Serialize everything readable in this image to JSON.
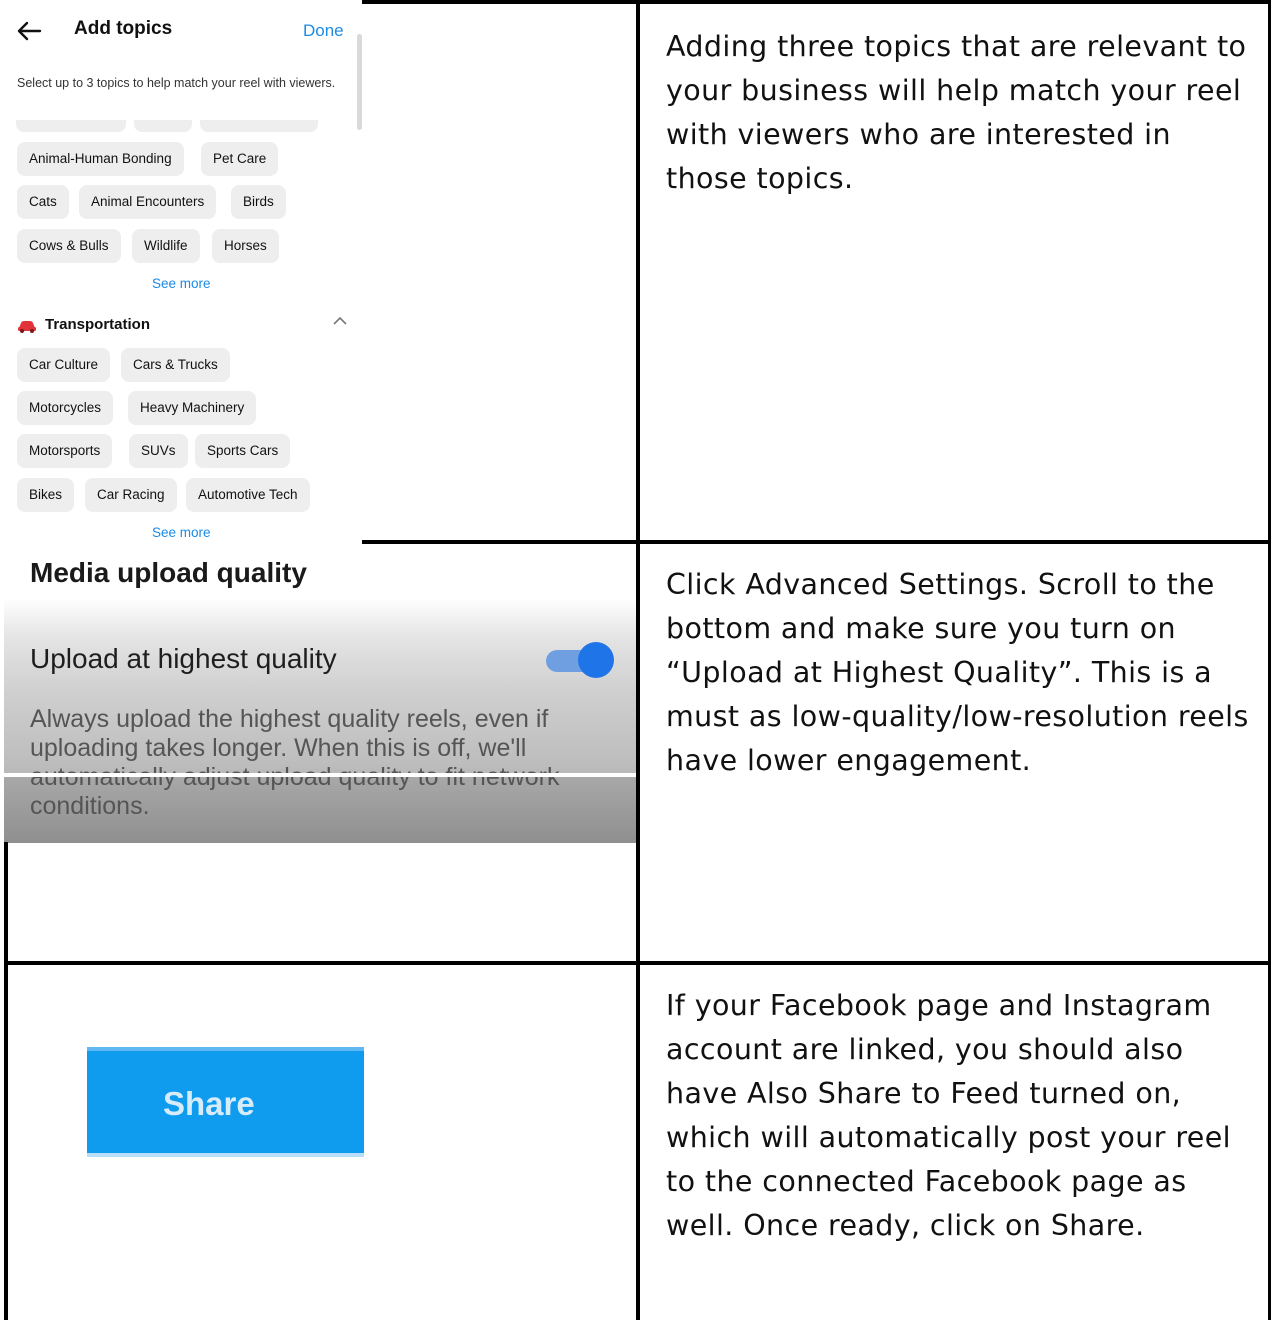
{
  "topics_screen": {
    "title": "Add topics",
    "done_label": "Done",
    "help_text": "Select up to 3 topics to help match your reel with viewers.",
    "animals_chips": [
      "Animal-Human Bonding",
      "Pet Care",
      "Cats",
      "Animal Encounters",
      "Birds",
      "Cows & Bulls",
      "Wildlife",
      "Horses"
    ],
    "see_more_label": "See more",
    "category": {
      "title": "Transportation",
      "chips": [
        "Car Culture",
        "Cars & Trucks",
        "Motorcycles",
        "Heavy Machinery",
        "Motorsports",
        "SUVs",
        "Sports Cars",
        "Bikes",
        "Car Racing",
        "Automotive Tech"
      ]
    },
    "accent_color": "#1c8be6"
  },
  "quality_screen": {
    "heading": "Media upload quality",
    "setting_label": "Upload at highest quality",
    "toggle_on": true,
    "description": "Always upload the highest quality reels, even if uploading takes longer. When this is off, we'll automatically adjust upload quality to fit network conditions.",
    "toggle_color": "#1f74e8"
  },
  "share_screen": {
    "button_label": "Share",
    "button_color": "#0f9bee"
  },
  "instructions": [
    "Adding three topics that are relevant to your business will help match your reel with viewers who are interested in those topics.",
    "Click Advanced Settings. Scroll to the bottom and make sure you turn on “Upload at Highest Quality”. This is a must as low-quality/low-resolution reels have lower engagement.",
    "If your Facebook page and Instagram account are linked, you should also have Also Share to Feed turned on, which will automatically post your reel to the connected Facebook page as well. Once ready, click on Share."
  ]
}
